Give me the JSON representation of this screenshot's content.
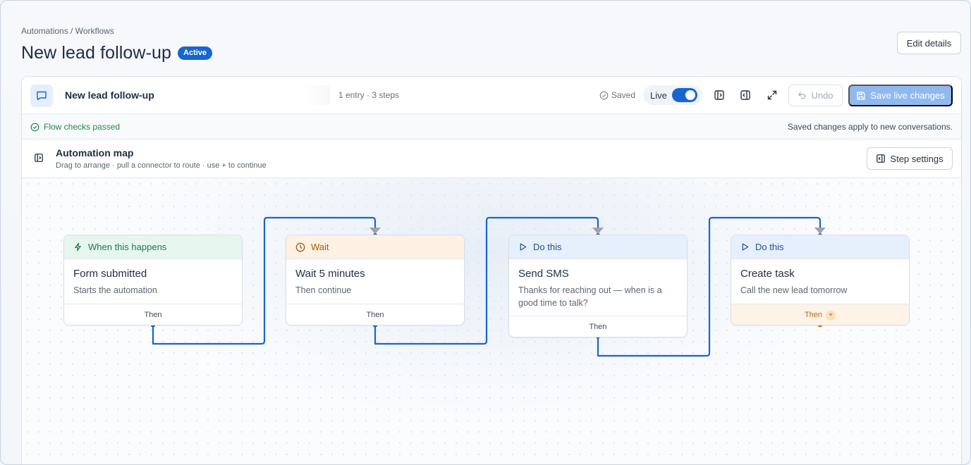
{
  "breadcrumb": "Automations / Workflows",
  "page_title": "New lead follow-up",
  "status_badge": "Active",
  "edit_details_label": "Edit details",
  "toolbar": {
    "flow_name_value": "New lead follow-up",
    "meta": "1 entry · 3 steps",
    "saved_label": "Saved",
    "live_label": "Live",
    "live_on": true,
    "undo_label": "Undo",
    "save_live_label": "Save live changes"
  },
  "checks": {
    "passed_label": "Flow checks passed",
    "note": "Saved changes apply to new conversations."
  },
  "map": {
    "title": "Automation map",
    "subtitle": "Drag to arrange · pull a connector to route · use + to continue",
    "step_settings_label": "Step settings"
  },
  "nodes": [
    {
      "kind": "When this happens",
      "icon": "bolt-icon",
      "title": "Form submitted",
      "desc": "Starts the automation",
      "foot": "Then"
    },
    {
      "kind": "Wait",
      "icon": "clock-icon",
      "title": "Wait 5 minutes",
      "desc": "Then continue",
      "foot": "Then"
    },
    {
      "kind": "Do this",
      "icon": "play-icon",
      "title": "Send SMS",
      "desc": "Thanks for reaching out — when is a good time to talk?",
      "foot": "Then"
    },
    {
      "kind": "Do this",
      "icon": "play-icon",
      "title": "Create task",
      "desc": "Call the new lead tomorrow",
      "foot": "Then",
      "foot_plus": "+"
    }
  ],
  "colors": {
    "accent": "#1766cf",
    "trigger": "#1e7a46",
    "wait": "#a35a0b",
    "action": "#1e4f9c",
    "success": "#1e8a4c"
  }
}
